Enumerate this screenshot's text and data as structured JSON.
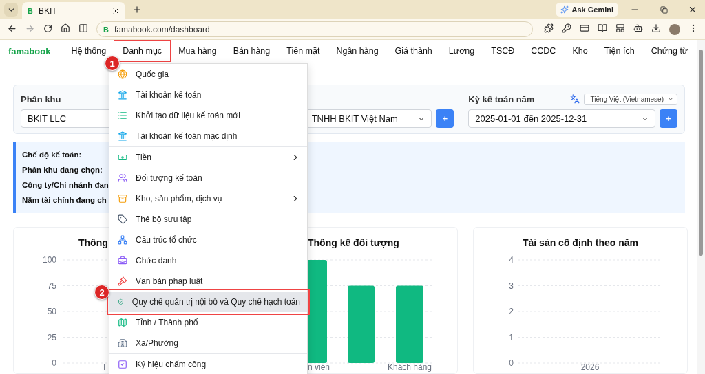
{
  "browser": {
    "tab": {
      "title": "BKIT",
      "favicon": "B"
    },
    "ask_button": "Ask Gemini",
    "url_favicon": "B",
    "url": "famabook.com/dashboard"
  },
  "nav": {
    "brand": "famabook",
    "items": [
      {
        "label": "Hệ thống",
        "annotated": false
      },
      {
        "label": "Danh mục",
        "annotated": true,
        "badge": "1"
      },
      {
        "label": "Mua hàng",
        "annotated": false
      },
      {
        "label": "Bán hàng",
        "annotated": false
      },
      {
        "label": "Tiền mặt",
        "annotated": false
      },
      {
        "label": "Ngân hàng",
        "annotated": false
      },
      {
        "label": "Giá thành",
        "annotated": false
      },
      {
        "label": "Lương",
        "annotated": false
      },
      {
        "label": "TSCĐ",
        "annotated": false
      },
      {
        "label": "CCDC",
        "annotated": false
      },
      {
        "label": "Kho",
        "annotated": false
      },
      {
        "label": "Tiện ích",
        "annotated": false
      },
      {
        "label": "Chứng từ",
        "annotated": false
      }
    ]
  },
  "menu": {
    "items": [
      {
        "label": "Quốc gia",
        "submenu": false,
        "divider_before": false,
        "selected": false,
        "annotated": false
      },
      {
        "label": "Tài khoản kế toán",
        "submenu": false,
        "divider_before": false,
        "selected": false,
        "annotated": false
      },
      {
        "label": "Khởi tạo dữ liệu kế toán mới",
        "submenu": false,
        "divider_before": false,
        "selected": false,
        "annotated": false
      },
      {
        "label": "Tài khoản kế toán mặc định",
        "submenu": false,
        "divider_before": false,
        "selected": false,
        "annotated": false
      },
      {
        "label": "Tiền",
        "submenu": true,
        "divider_before": true,
        "selected": false,
        "annotated": false
      },
      {
        "label": "Đối tượng kế toán",
        "submenu": false,
        "divider_before": false,
        "selected": false,
        "annotated": false
      },
      {
        "label": "Kho, sản phẩm, dịch vụ",
        "submenu": true,
        "divider_before": false,
        "selected": false,
        "annotated": false
      },
      {
        "label": "Thẻ bộ sưu tập",
        "submenu": false,
        "divider_before": false,
        "selected": false,
        "annotated": false
      },
      {
        "label": "Cấu trúc tổ chức",
        "submenu": false,
        "divider_before": false,
        "selected": false,
        "annotated": false
      },
      {
        "label": "Chức danh",
        "submenu": false,
        "divider_before": false,
        "selected": false,
        "annotated": false
      },
      {
        "label": "Văn bản pháp luật",
        "submenu": false,
        "divider_before": false,
        "selected": false,
        "annotated": false
      },
      {
        "label": "Quy chế quản trị nội bộ và Quy chế hạch toán",
        "submenu": false,
        "divider_before": false,
        "selected": true,
        "annotated": true,
        "badge": "2"
      },
      {
        "label": "Tỉnh / Thành phố",
        "submenu": false,
        "divider_before": false,
        "selected": false,
        "annotated": false
      },
      {
        "label": "Xã/Phường",
        "submenu": false,
        "divider_before": false,
        "selected": false,
        "annotated": false
      },
      {
        "label": "Ký hiệu chấm công",
        "submenu": false,
        "divider_before": true,
        "selected": false,
        "annotated": false
      }
    ]
  },
  "filters": {
    "fields": [
      {
        "label": "Phân khu",
        "value": "BKIT LLC",
        "kind": "plain"
      },
      {
        "value": "TNHH BKIT Việt Nam",
        "kind": "select",
        "add_button": "+"
      },
      {
        "label": "Kỳ kế toán năm",
        "value": "2025-01-01 đến 2025-12-31",
        "kind": "select",
        "add_button": "+"
      }
    ],
    "language": "Tiếng Việt (Vietnamese)"
  },
  "info": {
    "lines": [
      "Chế độ kế toán:",
      "Phân khu đang chọn:",
      "Công ty/Chi nhánh đan",
      "Năm tài chính đang ch"
    ]
  },
  "charts": [
    {
      "kind": "axis",
      "title": "Thống",
      "yticks": [
        "100",
        "75",
        "50",
        "25",
        "0"
      ],
      "xlabels": [
        "T"
      ]
    },
    {
      "kind": "bars",
      "title": "Thống kê đối tượng",
      "xlabels": [
        "n viên",
        "Khách hàng"
      ]
    },
    {
      "kind": "chart",
      "chart_data": {
        "type": "bar",
        "title": "Tài sản cố định theo năm",
        "categories": [
          "2026"
        ],
        "values": [
          0
        ],
        "ylim": [
          0,
          4
        ],
        "yticks": [
          0,
          1,
          2,
          3,
          4
        ],
        "grid": true
      }
    }
  ]
}
